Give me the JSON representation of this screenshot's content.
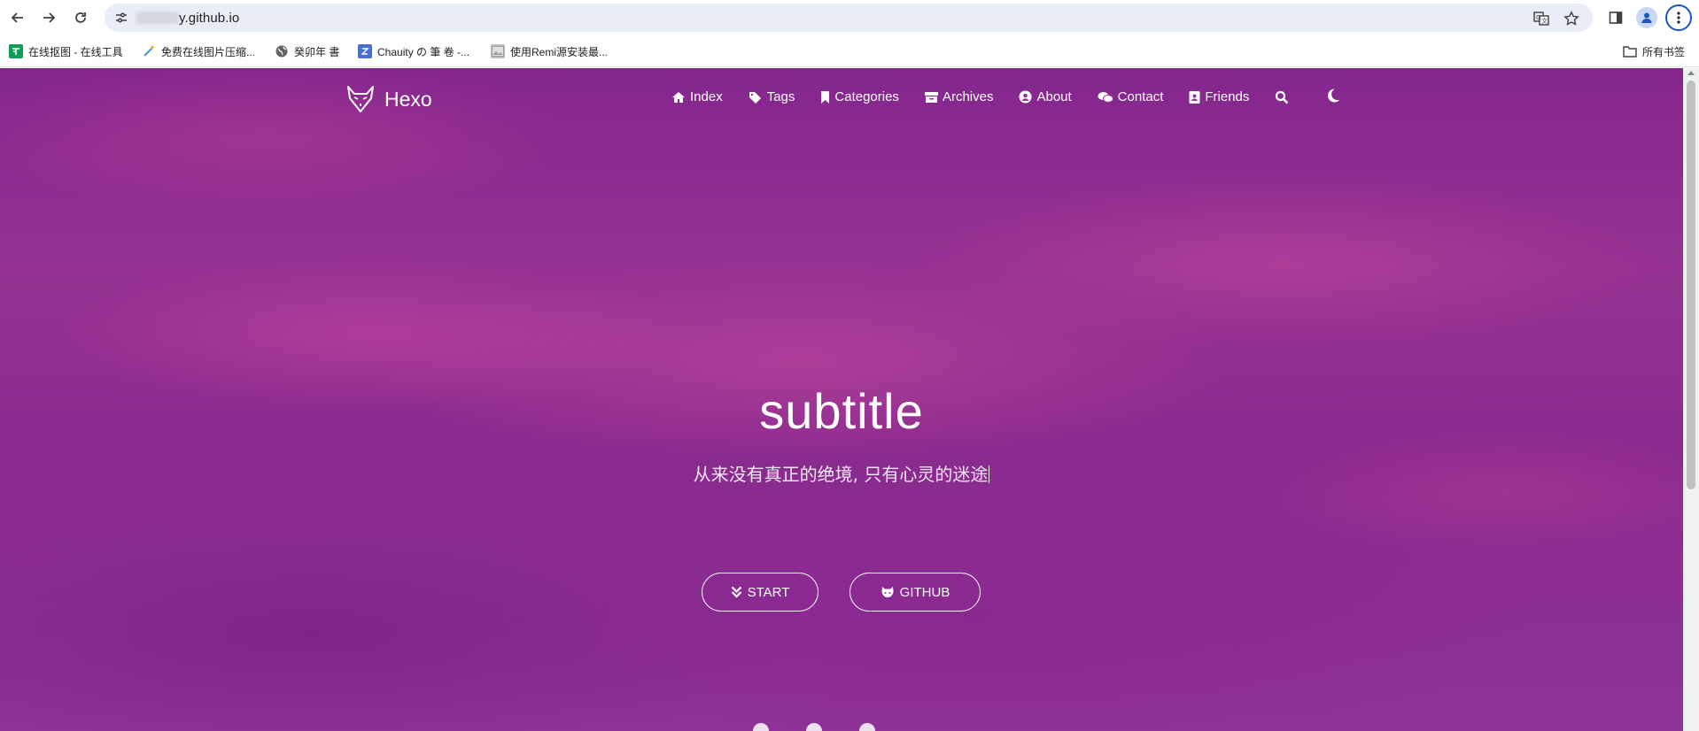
{
  "browser": {
    "url": "y.github.io",
    "bookmarks": [
      {
        "label": "在线抠图 - 在线工具",
        "icon": "sheet-icon",
        "color": "#0f9d58"
      },
      {
        "label": "免费在线图片压缩...",
        "icon": "magic-wand-icon",
        "color": "#4a90e2"
      },
      {
        "label": "癸卯年 書",
        "icon": "globe-icon",
        "color": "#5f6368"
      },
      {
        "label": "Chauity の 筆 卷 -...",
        "icon": "letter-z-icon",
        "color": "#4a6fd0"
      },
      {
        "label": "使用Remi源安装最...",
        "icon": "image-icon",
        "color": "#9e9e9e"
      }
    ],
    "all_bookmarks": "所有书签"
  },
  "site": {
    "brand": "Hexo",
    "nav": [
      "Index",
      "Tags",
      "Categories",
      "Archives",
      "About",
      "Contact",
      "Friends"
    ],
    "hero_title": "subtitle",
    "slogan": "从来没有真正的绝境, 只有心灵的迷途",
    "buttons": {
      "start": "START",
      "github": "GITHUB"
    }
  },
  "colors": {
    "hero_base": "#963199",
    "text": "#ffffff"
  }
}
